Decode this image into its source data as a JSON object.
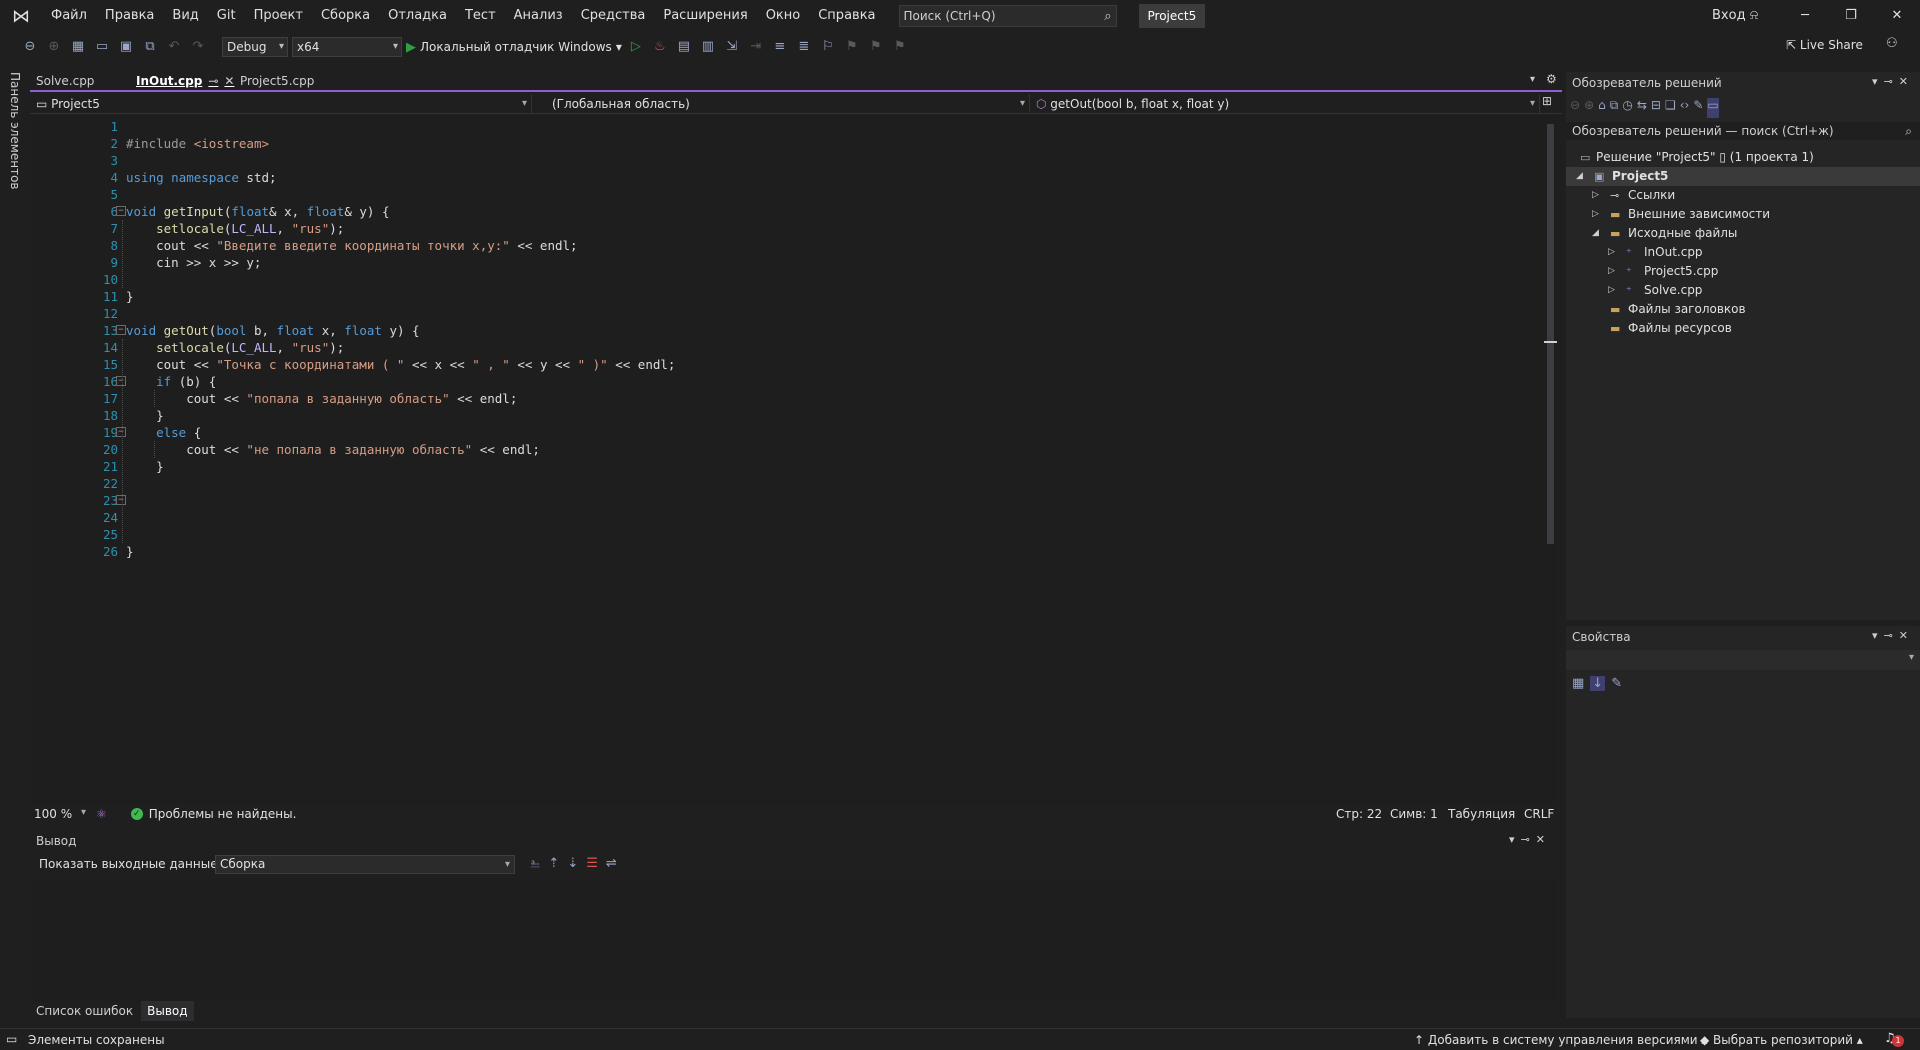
{
  "menubar": {
    "items": [
      "Файл",
      "Правка",
      "Вид",
      "Git",
      "Проект",
      "Сборка",
      "Отладка",
      "Тест",
      "Анализ",
      "Средства",
      "Расширения",
      "Окно",
      "Справка"
    ],
    "search_placeholder": "Поиск (Ctrl+Q)",
    "project_name": "Project5",
    "signin": "Вход"
  },
  "toolbar": {
    "configuration": "Debug",
    "platform": "x64",
    "debugger": "Локальный отладчик Windows",
    "live_share": "Live Share"
  },
  "toolbox": {
    "label": "Панель элементов"
  },
  "doc_tabs": [
    {
      "label": "Solve.cpp",
      "active": false
    },
    {
      "label": "InOut.cpp",
      "active": true
    },
    {
      "label": "Project5.cpp",
      "active": false
    }
  ],
  "navbar": {
    "project": "Project5",
    "scope": "(Глобальная область)",
    "member": "getOut(bool b, float x, float y)"
  },
  "code": {
    "lines": [
      "",
      "#include <iostream>",
      "",
      "using namespace std;",
      "",
      "void getInput(float& x, float& y) {",
      "    setlocale(LC_ALL, \"rus\");",
      "    cout << \"Введите введите координаты точки x,y:\" << endl;",
      "    cin >> x >> y;",
      "",
      "}",
      "",
      "void getOut(bool b, float x, float y) {",
      "    setlocale(LC_ALL, \"rus\");",
      "    cout << \"Точка с координатами ( \" << x << \" , \" << y << \" )\" << endl;",
      "    if (b) {",
      "        cout << \"попала в заданную область\" << endl;",
      "    }",
      "    else {",
      "        cout << \"не попала в заданную область\" << endl;",
      "    }",
      "",
      "",
      "",
      "",
      "}"
    ]
  },
  "editor_status": {
    "zoom": "100 %",
    "problems": "Проблемы не найдены.",
    "line": "Стр: 22",
    "col": "Симв: 1",
    "indent": "Табуляция",
    "eol": "CRLF"
  },
  "output": {
    "title": "Вывод",
    "show_label": "Показать выходные данные из:",
    "source": "Сборка"
  },
  "bottom_tabs": [
    {
      "label": "Список ошибок",
      "active": false
    },
    {
      "label": "Вывод",
      "active": true
    }
  ],
  "solution_explorer": {
    "title": "Обозреватель решений",
    "search_placeholder": "Обозреватель решений — поиск (Ctrl+ж)",
    "tree": [
      {
        "label": "Решение \"Project5\" ▯ (1 проекта 1)",
        "level": 0,
        "arrow": "",
        "icon": "solution-icon",
        "selected": false
      },
      {
        "label": "Project5",
        "level": 0,
        "arrow": "◢",
        "icon": "project-icon",
        "selected": true
      },
      {
        "label": "Ссылки",
        "level": 1,
        "arrow": "▷",
        "icon": "references-icon",
        "selected": false
      },
      {
        "label": "Внешние зависимости",
        "level": 1,
        "arrow": "▷",
        "icon": "folder-icon",
        "selected": false
      },
      {
        "label": "Исходные файлы",
        "level": 1,
        "arrow": "◢",
        "icon": "folder-icon",
        "selected": false
      },
      {
        "label": "InOut.cpp",
        "level": 2,
        "arrow": "▷",
        "icon": "cpp-file-icon",
        "selected": false
      },
      {
        "label": "Project5.cpp",
        "level": 2,
        "arrow": "▷",
        "icon": "cpp-file-icon",
        "selected": false
      },
      {
        "label": "Solve.cpp",
        "level": 2,
        "arrow": "▷",
        "icon": "cpp-file-icon",
        "selected": false
      },
      {
        "label": "Файлы заголовков",
        "level": 1,
        "arrow": "",
        "icon": "folder-icon",
        "selected": false
      },
      {
        "label": "Файлы ресурсов",
        "level": 1,
        "arrow": "",
        "icon": "folder-icon",
        "selected": false
      }
    ]
  },
  "properties": {
    "title": "Свойства"
  },
  "statusbar": {
    "message": "Элементы сохранены",
    "vcs": "Добавить в систему управления версиями",
    "repo": "Выбрать репозиторий",
    "notifications": "1"
  },
  "colors": {
    "accent": "#8f5ed3",
    "line_number": "#2b91af",
    "ok": "#3fb950"
  }
}
